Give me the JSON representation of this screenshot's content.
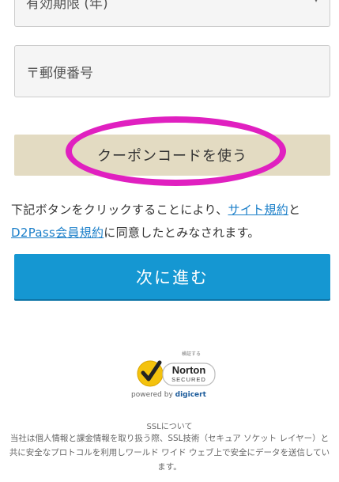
{
  "form": {
    "expiry_label": "有効期限 (年)",
    "zip_placeholder": "〒郵便番号",
    "coupon_button": "クーポンコードを使う",
    "next_button": "次に進む"
  },
  "terms": {
    "prefix": "下記ボタンをクリックすることにより、",
    "site_terms_link": "サイト規約",
    "and": "と",
    "member_terms_link": "D2Pass会員規約",
    "suffix": "に同意したとみなされます。"
  },
  "seal": {
    "verify_text": "検証する",
    "brand": "Norton",
    "secured": "SECURED",
    "powered_prefix": "powered by",
    "powered_brand": "digicert"
  },
  "ssl": {
    "title": "SSLについて",
    "body": "当社は個人情報と課金情報を取り扱う際、SSL技術（セキュア ソケット レイヤー）と共に安全なプロトコルを利用しワールド ワイド ウェブ上で安全にデータを送信しています。"
  },
  "colors": {
    "coupon_bg": "#e3dbc2",
    "next_bg": "#1597d2",
    "highlight_circle": "#e020c0",
    "link": "#1b7fc9"
  }
}
